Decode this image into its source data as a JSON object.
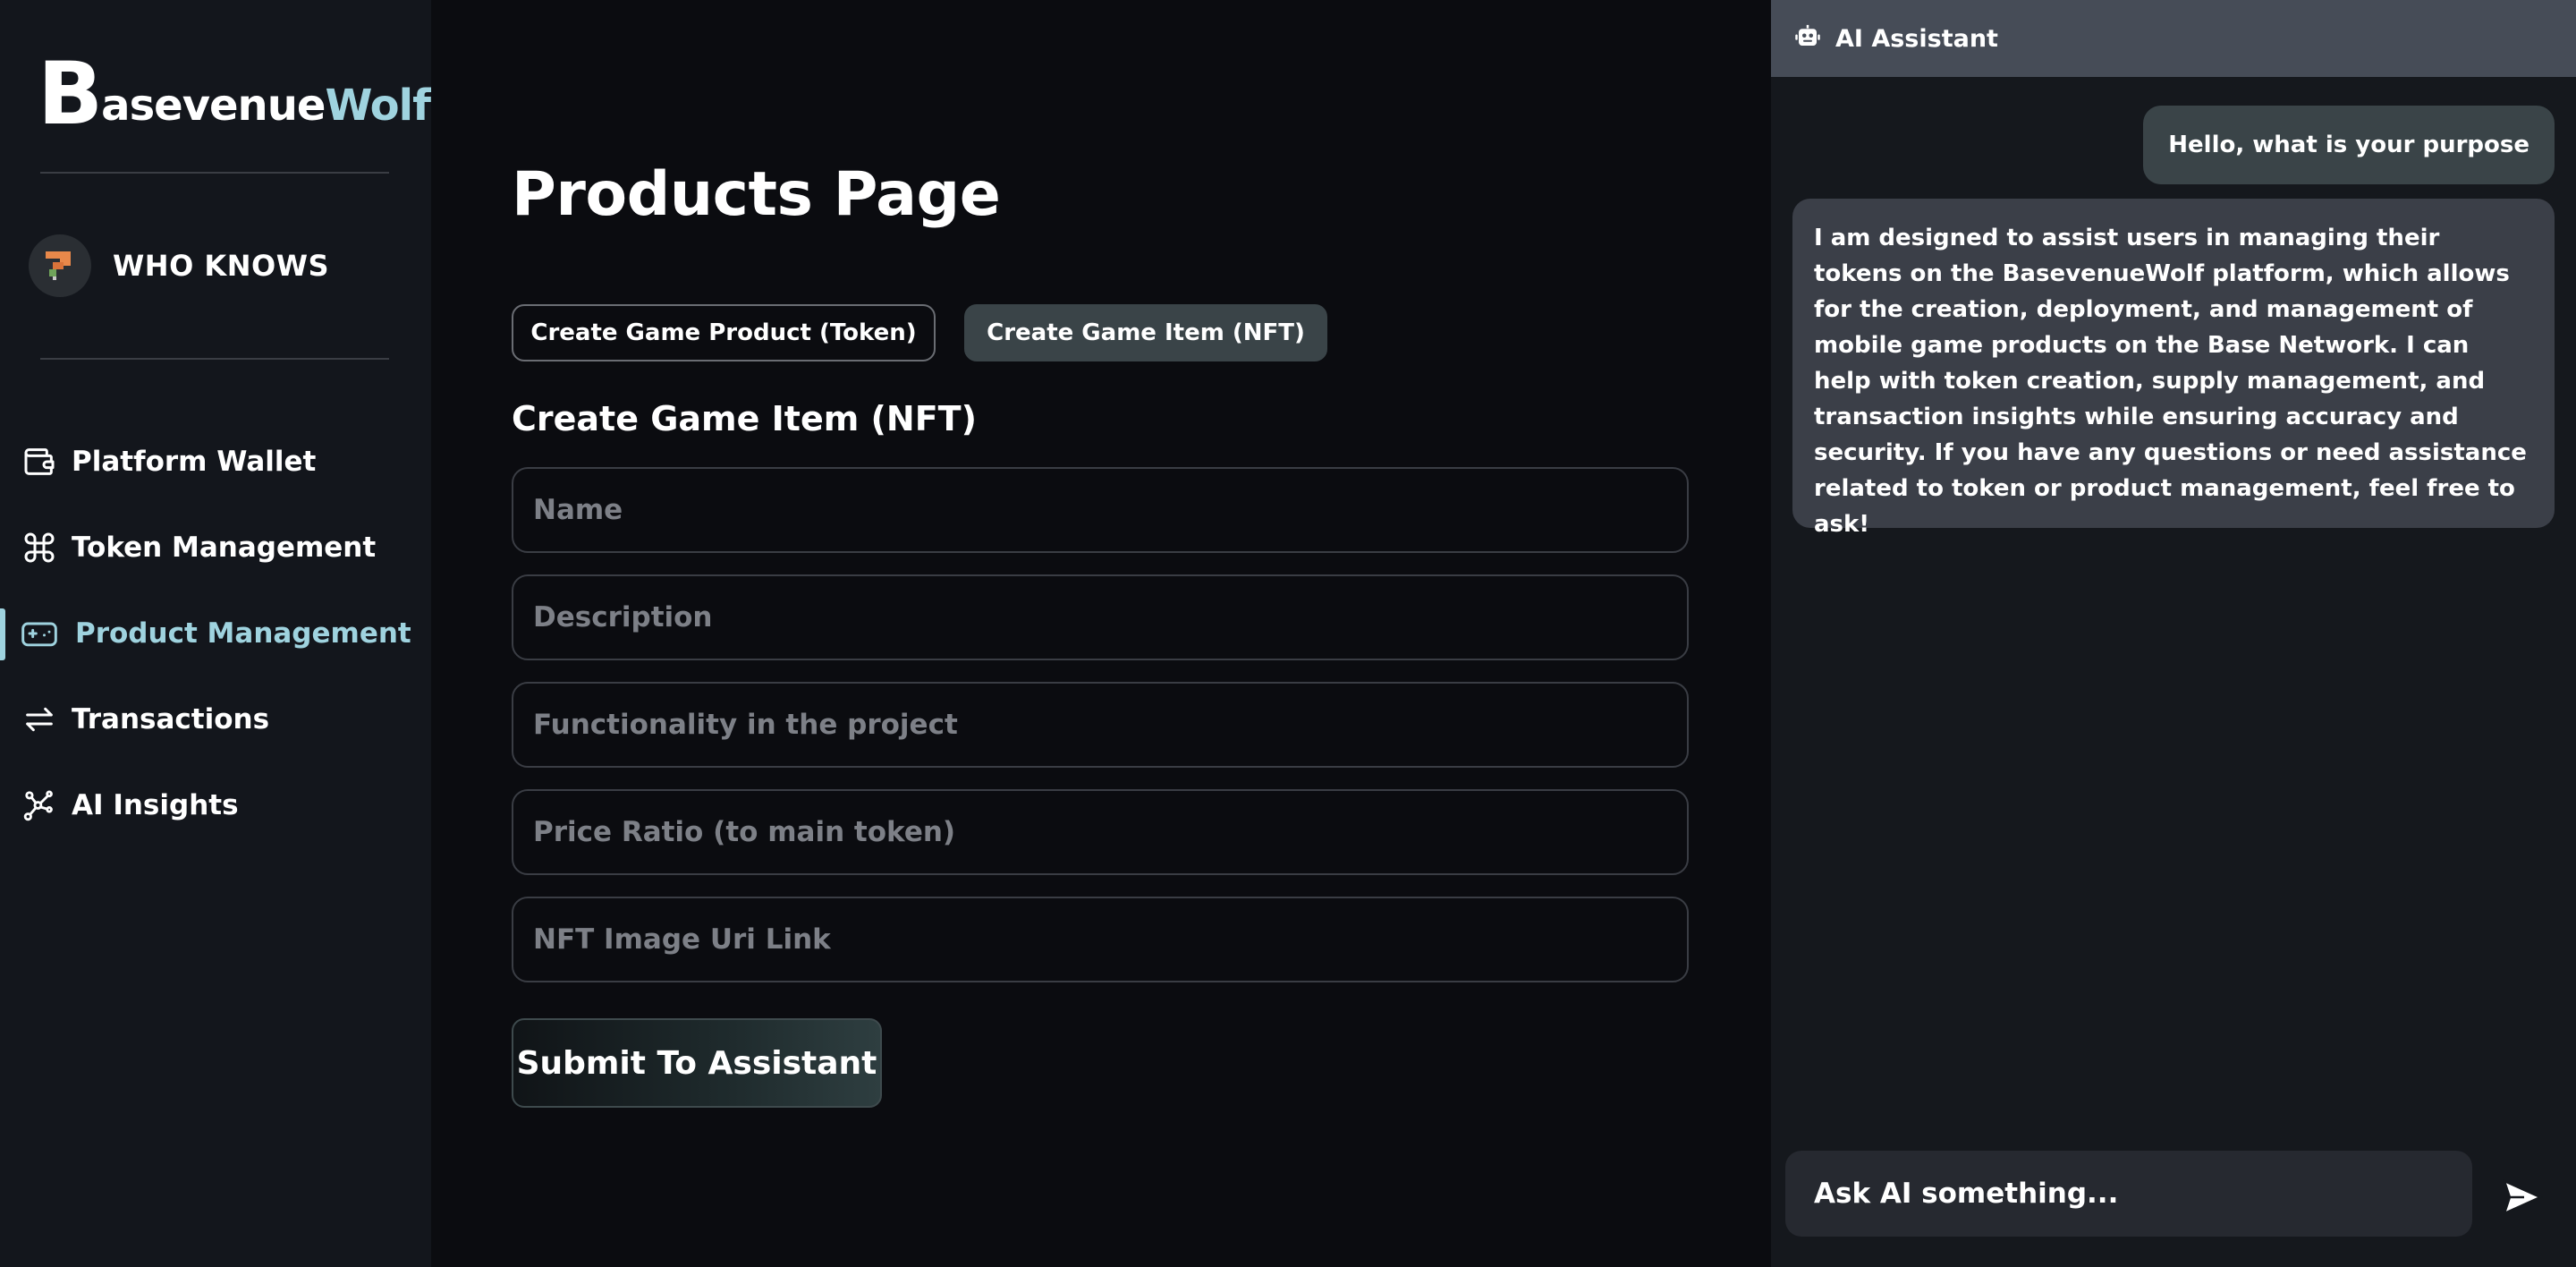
{
  "app": {
    "logo_initial": "B",
    "logo_part1": "asevenue",
    "logo_part2": "Wolf",
    "accent_color": "#9fd3df"
  },
  "user": {
    "name": "WHO KNOWS",
    "avatar_icon": "pixel-avatar-icon"
  },
  "sidebar": {
    "items": [
      {
        "label": "Platform Wallet",
        "icon": "wallet-icon",
        "active": false
      },
      {
        "label": "Token Management",
        "icon": "command-icon",
        "active": false
      },
      {
        "label": "Product Management",
        "icon": "gamepad-icon",
        "active": true
      },
      {
        "label": "Transactions",
        "icon": "arrows-exchange-icon",
        "active": false
      },
      {
        "label": "AI Insights",
        "icon": "network-nodes-icon",
        "active": false
      }
    ]
  },
  "main": {
    "title": "Products Page",
    "tabs": [
      {
        "label": "Create Game Product (Token)",
        "active": false
      },
      {
        "label": "Create Game Item (NFT)",
        "active": true
      }
    ],
    "section_title": "Create Game Item (NFT)",
    "fields": [
      {
        "placeholder": "Name",
        "value": ""
      },
      {
        "placeholder": "Description",
        "value": ""
      },
      {
        "placeholder": "Functionality in the project",
        "value": ""
      },
      {
        "placeholder": "Price Ratio (to main token)",
        "value": ""
      },
      {
        "placeholder": "NFT Image Uri Link",
        "value": ""
      }
    ],
    "submit_label": "Submit To Assistant"
  },
  "assistant": {
    "title": "AI Assistant",
    "header_icon": "robot-icon",
    "messages": [
      {
        "role": "user",
        "text": "Hello, what is your purpose"
      },
      {
        "role": "assistant",
        "text": "I am designed to assist users in managing their tokens on the BasevenueWolf platform, which allows for the creation, deployment, and management of mobile game products on the Base Network. I can help with token creation, supply management, and transaction insights while ensuring accuracy and security. If you have any questions or need assistance related to token or product management, feel free to ask!"
      }
    ],
    "input_placeholder": "Ask AI something...",
    "input_value": "",
    "send_icon": "send-icon"
  }
}
